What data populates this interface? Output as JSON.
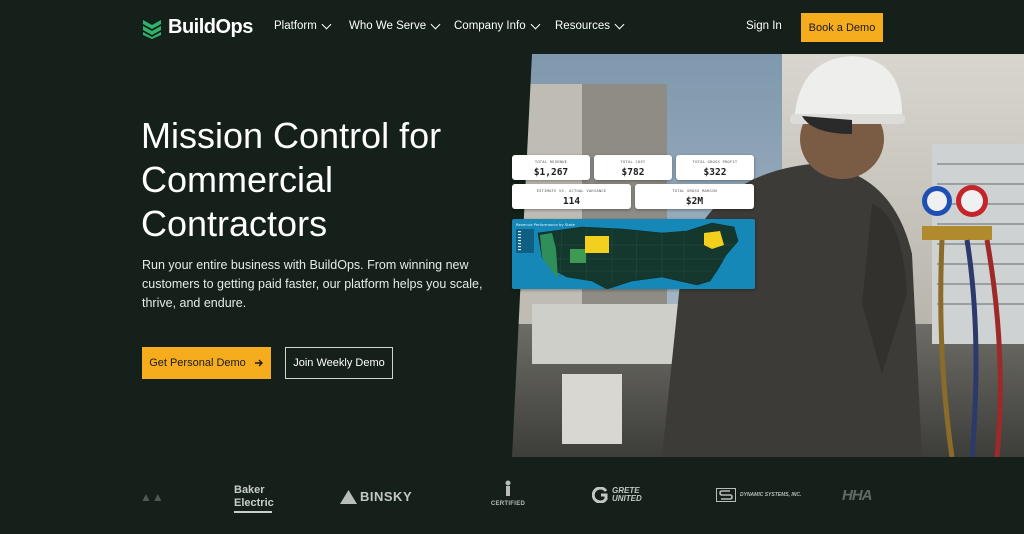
{
  "brand": {
    "name": "BuildOps",
    "accent": "#f5ad1e",
    "logo_green": "#2fb36b",
    "background": "#142019"
  },
  "nav": {
    "items": [
      {
        "label": "Platform"
      },
      {
        "label": "Who We Serve"
      },
      {
        "label": "Company Info"
      },
      {
        "label": "Resources"
      }
    ],
    "sign_in": "Sign In",
    "cta": "Book a Demo"
  },
  "hero": {
    "headline_lines": [
      "Mission Control for",
      "Commercial",
      "Contractors"
    ],
    "subtext": "Run your entire business with BuildOps. From winning new customers to getting paid faster, our platform helps you scale, thrive, and endure.",
    "primary_button": "Get Personal Demo",
    "secondary_button": "Join Weekly Demo"
  },
  "dashboard": {
    "cards": [
      {
        "label": "TOTAL REVENUE",
        "value": "$1,267"
      },
      {
        "label": "TOTAL COST",
        "value": "$782"
      },
      {
        "label": "TOTAL GROSS PROFIT",
        "value": "$322"
      },
      {
        "label": "ESTIMATE VS. ACTUAL VARIANCE",
        "value": "114"
      },
      {
        "label": "TOTAL GROSS MARGIN",
        "value": "$2M"
      }
    ],
    "map_title": "Revenue Performance by State"
  },
  "customer_logos": [
    {
      "name": "Baker Electric"
    },
    {
      "name": "BINSKY"
    },
    {
      "name": "CERTIFIED"
    },
    {
      "name": "GRETE UNITED"
    },
    {
      "name": "DYNAMIC SYSTEMS, INC."
    }
  ]
}
